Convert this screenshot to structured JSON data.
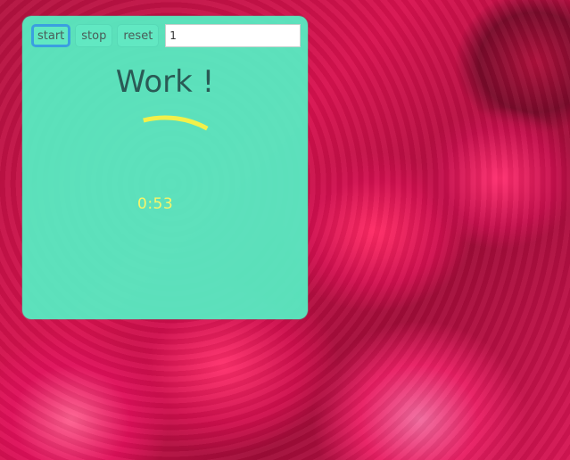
{
  "toolbar": {
    "start_label": "start",
    "stop_label": "stop",
    "reset_label": "reset",
    "count_value": "1"
  },
  "heading": "Work !",
  "timer": {
    "display": "0:53",
    "progress_fraction": 0.12,
    "ring_color": "#f2f04a"
  },
  "colors": {
    "panel": "#54f0c4",
    "focus_outline": "#3a9fe0",
    "heading_text": "#2a5a55",
    "timer_text": "#f7f56a"
  }
}
